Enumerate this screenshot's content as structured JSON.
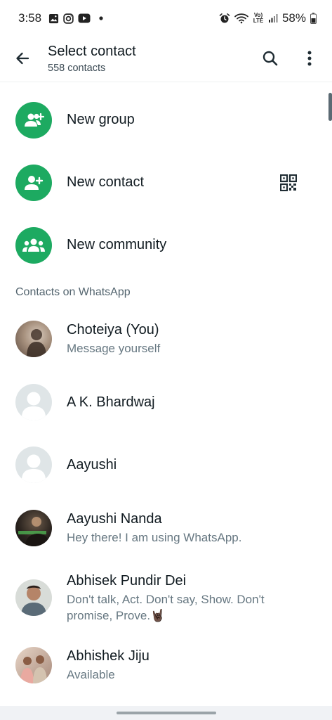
{
  "status_bar": {
    "time": "3:58",
    "battery": "58%",
    "network_label": "Vo) LTE"
  },
  "header": {
    "title": "Select contact",
    "subtitle": "558 contacts"
  },
  "actions": {
    "new_group": "New group",
    "new_contact": "New contact",
    "new_community": "New community"
  },
  "section_title": "Contacts on WhatsApp",
  "contacts": [
    {
      "name": "Choteiya (You)",
      "status": "Message yourself"
    },
    {
      "name": "A K. Bhardwaj",
      "status": ""
    },
    {
      "name": "Aayushi",
      "status": ""
    },
    {
      "name": "Aayushi Nanda",
      "status": "Hey there! I am using WhatsApp."
    },
    {
      "name": "Abhisek Pundir Dei",
      "status": "Don't talk, Act. Don't say, Show. Don't promise, Prove.🤘🏿"
    },
    {
      "name": "Abhishek Jiju",
      "status": "Available"
    }
  ],
  "colors": {
    "accent": "#1daa61",
    "default_avatar": "#dfe5e7",
    "text_primary": "#111b21",
    "text_secondary": "#667781"
  }
}
